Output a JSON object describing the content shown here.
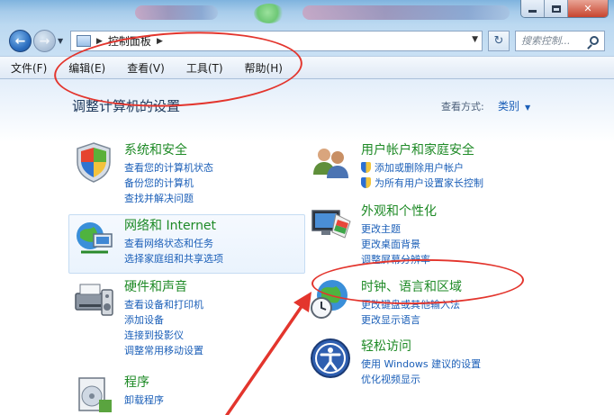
{
  "window": {
    "controls": {
      "minimize": "",
      "maximize": "",
      "close": "✕"
    }
  },
  "address": {
    "breadcrumb": [
      "控制面板"
    ],
    "search_placeholder": "搜索控制..."
  },
  "menu": [
    "文件(F)",
    "编辑(E)",
    "查看(V)",
    "工具(T)",
    "帮助(H)"
  ],
  "content": {
    "heading": "调整计算机的设置",
    "view_by_label": "查看方式:",
    "view_by_value": "类别",
    "categories": [
      {
        "title": "系统和安全",
        "icon": "system-security-icon",
        "links": [
          "查看您的计算机状态",
          "备份您的计算机",
          "查找并解决问题"
        ]
      },
      {
        "title": "网络和 Internet",
        "icon": "network-icon",
        "links": [
          "查看网络状态和任务",
          "选择家庭组和共享选项"
        ]
      },
      {
        "title": "硬件和声音",
        "icon": "hardware-sound-icon",
        "links": [
          "查看设备和打印机",
          "添加设备",
          "连接到投影仪",
          "调整常用移动设置"
        ]
      },
      {
        "title": "程序",
        "icon": "programs-icon",
        "links": [
          "卸载程序"
        ]
      },
      {
        "title": "用户帐户和家庭安全",
        "icon": "user-accounts-icon",
        "links": [
          "添加或删除用户帐户",
          "为所有用户设置家长控制"
        ]
      },
      {
        "title": "外观和个性化",
        "icon": "appearance-icon",
        "links": [
          "更改主题",
          "更改桌面背景",
          "调整屏幕分辨率"
        ]
      },
      {
        "title": "时钟、语言和区域",
        "icon": "clock-language-region-icon",
        "links": [
          "更改键盘或其他输入法",
          "更改显示语言"
        ]
      },
      {
        "title": "轻松访问",
        "icon": "ease-of-access-icon",
        "links": [
          "使用 Windows 建议的设置",
          "优化视频显示"
        ]
      }
    ]
  },
  "colors": {
    "category_title": "#1e8a26",
    "link": "#1b5fb8",
    "heading": "#1e395b",
    "annotation": "#e3352d"
  }
}
